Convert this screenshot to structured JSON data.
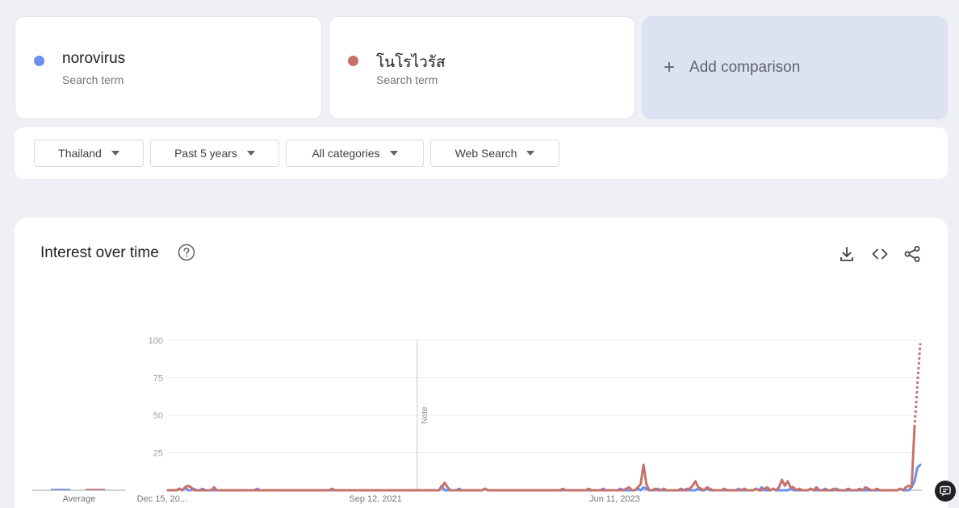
{
  "terms": [
    {
      "name": "norovirus",
      "subtitle": "Search term",
      "color": "#6d8ff0"
    },
    {
      "name": "โนโรไวรัส",
      "subtitle": "Search term",
      "color": "#c5736a"
    }
  ],
  "add_comparison": {
    "plus": "+",
    "label": "Add comparison"
  },
  "filters": {
    "region": "Thailand",
    "time": "Past 5 years",
    "category": "All categories",
    "search_type": "Web Search"
  },
  "chart_card": {
    "title": "Interest over time"
  },
  "average_label": "Average",
  "chart_data": {
    "type": "line",
    "ylim": [
      0,
      100
    ],
    "yticks": [
      "100",
      "75",
      "50",
      "25"
    ],
    "x_tick_labels": [
      "Dec 15, 20...",
      "Sep 12, 2021",
      "Jun 11, 2023"
    ],
    "annotation": "Note",
    "x_start_date": "2019-12-15",
    "week_count": 262,
    "series": [
      {
        "name": "norovirus",
        "color": "#6d8ff0",
        "average": 1,
        "spikes": [
          [
            4,
            1
          ],
          [
            6,
            2
          ],
          [
            9,
            1
          ],
          [
            12,
            1
          ],
          [
            31,
            1
          ],
          [
            95,
            3
          ],
          [
            101,
            1
          ],
          [
            110,
            1
          ],
          [
            151,
            1
          ],
          [
            157,
            1
          ],
          [
            163,
            1
          ],
          [
            165,
            2
          ],
          [
            166,
            1
          ],
          [
            170,
            1
          ],
          [
            180,
            1
          ],
          [
            184,
            1
          ],
          [
            187,
            1
          ],
          [
            198,
            1
          ],
          [
            204,
            1
          ],
          [
            206,
            2
          ],
          [
            210,
            1
          ],
          [
            216,
            1
          ],
          [
            223,
            1
          ],
          [
            228,
            1
          ],
          [
            232,
            1
          ],
          [
            254,
            1
          ],
          [
            258,
            2
          ],
          [
            259,
            6
          ],
          [
            260,
            15
          ],
          [
            261,
            17
          ]
        ]
      },
      {
        "name": "โนโรไวรัส",
        "color": "#c5736a",
        "average": 1,
        "spikes": [
          [
            4,
            1
          ],
          [
            6,
            2
          ],
          [
            7,
            3
          ],
          [
            8,
            2
          ],
          [
            16,
            2
          ],
          [
            57,
            1
          ],
          [
            95,
            2
          ],
          [
            96,
            5
          ],
          [
            97,
            2
          ],
          [
            110,
            1
          ],
          [
            137,
            1
          ],
          [
            146,
            1
          ],
          [
            159,
            1
          ],
          [
            160,
            2
          ],
          [
            163,
            2
          ],
          [
            164,
            4
          ],
          [
            165,
            17
          ],
          [
            166,
            4
          ],
          [
            169,
            1
          ],
          [
            172,
            1
          ],
          [
            178,
            1
          ],
          [
            181,
            1
          ],
          [
            182,
            3
          ],
          [
            183,
            6
          ],
          [
            184,
            2
          ],
          [
            185,
            1
          ],
          [
            187,
            2
          ],
          [
            188,
            1
          ],
          [
            193,
            1
          ],
          [
            200,
            1
          ],
          [
            204,
            1
          ],
          [
            207,
            1
          ],
          [
            208,
            2
          ],
          [
            210,
            1
          ],
          [
            212,
            2
          ],
          [
            213,
            7
          ],
          [
            214,
            3
          ],
          [
            215,
            6
          ],
          [
            216,
            2
          ],
          [
            217,
            2
          ],
          [
            219,
            1
          ],
          [
            223,
            1
          ],
          [
            225,
            2
          ],
          [
            231,
            1
          ],
          [
            236,
            1
          ],
          [
            240,
            1
          ],
          [
            242,
            2
          ],
          [
            243,
            1
          ],
          [
            246,
            1
          ],
          [
            254,
            1
          ],
          [
            256,
            2
          ],
          [
            257,
            3
          ],
          [
            258,
            2
          ],
          [
            259,
            42
          ]
        ],
        "partial_from": 259,
        "partial_value": 98
      }
    ]
  }
}
